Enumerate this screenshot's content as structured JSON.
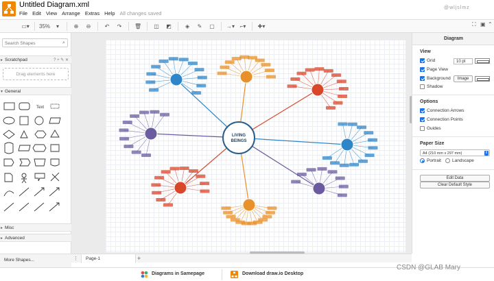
{
  "app": {
    "title": "Untitled Diagram.xml",
    "saved": "All changes saved",
    "watermark": "@wljslmz",
    "csdn": "CSDN @GLAB Mary"
  },
  "menu": [
    "File",
    "Edit",
    "View",
    "Arrange",
    "Extras",
    "Help"
  ],
  "toolbar": {
    "zoom": "35%"
  },
  "sidebar": {
    "search_placeholder": "Search Shapes",
    "scratchpad": "Scratchpad",
    "drop_text": "Drag elements here",
    "general": "General",
    "text_shape": "Text",
    "misc": "Misc",
    "advanced": "Advanced",
    "more_shapes": "More Shapes..."
  },
  "panel": {
    "header": "Diagram",
    "view_title": "View",
    "grid": "Grid",
    "grid_size": "10 pt",
    "page_view": "Page View",
    "background": "Background",
    "image_btn": "Image",
    "shadow": "Shadow",
    "options_title": "Options",
    "connection_arrows": "Connection Arrows",
    "connection_points": "Connection Points",
    "guides": "Guides",
    "paper_title": "Paper Size",
    "paper_value": "A4 (210 mm x 297 mm)",
    "portrait": "Portrait",
    "landscape": "Landscape",
    "edit_data": "Edit Data",
    "clear_style": "Clear Default Style"
  },
  "pages": {
    "tab": "Page-1"
  },
  "footer": {
    "samepage": "Diagrams in Samepage",
    "desktop": "Download draw.io Desktop"
  },
  "diagram": {
    "center_line1": "LIVING",
    "center_line2": "BEINGS",
    "colors": {
      "blue": "#2e86c9",
      "orange": "#e8902a",
      "red": "#d9472b",
      "purple": "#6a5c9e",
      "center": "#2a5d88"
    }
  }
}
